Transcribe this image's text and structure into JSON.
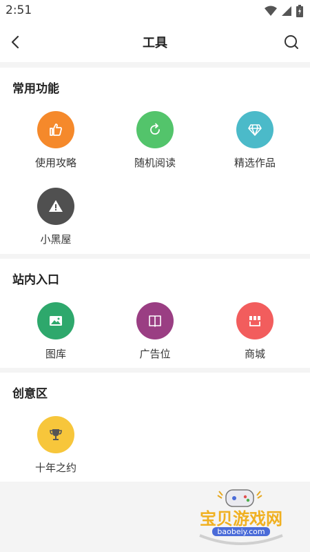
{
  "status_bar": {
    "time": "2:51"
  },
  "app_bar": {
    "title": "工具"
  },
  "sections": {
    "common": {
      "title": "常用功能",
      "items": [
        {
          "label": "使用攻略",
          "color": "#f5892b",
          "icon": "thumbs-up-icon"
        },
        {
          "label": "随机阅读",
          "color": "#53c46b",
          "icon": "refresh-icon"
        },
        {
          "label": "精选作品",
          "color": "#4bbac9",
          "icon": "diamond-icon"
        },
        {
          "label": "小黑屋",
          "color": "#505050",
          "icon": "warning-icon"
        }
      ]
    },
    "site": {
      "title": "站内入口",
      "items": [
        {
          "label": "图库",
          "color": "#2ea86c",
          "icon": "image-icon"
        },
        {
          "label": "广告位",
          "color": "#9a3e83",
          "icon": "book-icon"
        },
        {
          "label": "商城",
          "color": "#f25d5d",
          "icon": "shop-icon"
        }
      ]
    },
    "creative": {
      "title": "创意区",
      "items": [
        {
          "label": "十年之约",
          "color": "#f7c63b",
          "icon": "trophy-icon"
        }
      ]
    }
  },
  "watermark": {
    "logo_text": "宝贝游戏网",
    "url_text": "baobeiy.com"
  }
}
